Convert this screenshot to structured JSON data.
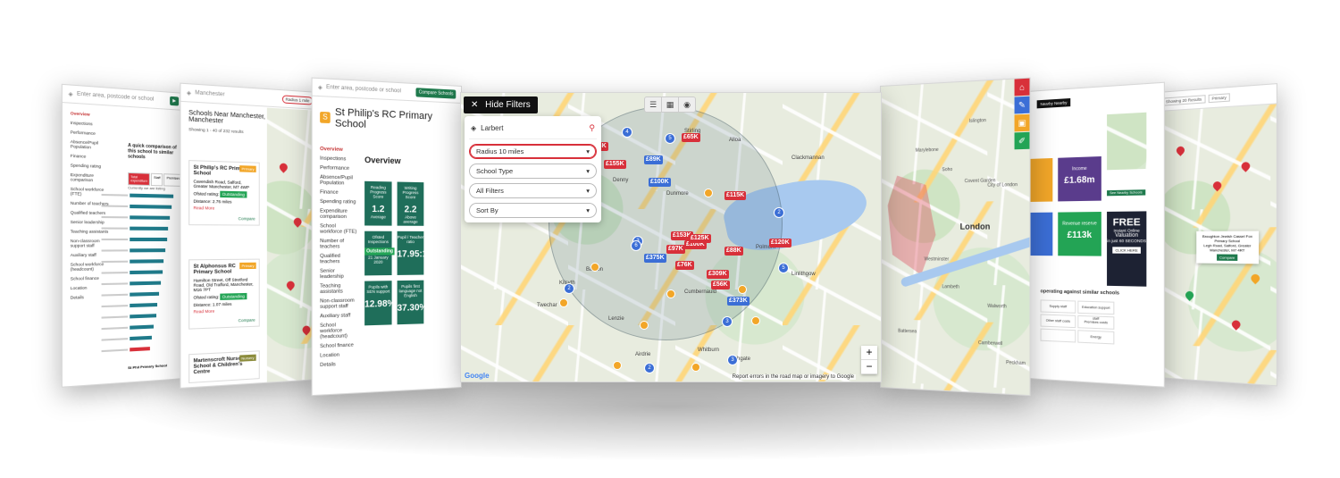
{
  "center": {
    "hide_filters": "Hide Filters",
    "search_value": "Larbert",
    "filters": [
      {
        "label": "Radius 10 miles",
        "active": true
      },
      {
        "label": "School Type",
        "active": false
      },
      {
        "label": "All Filters",
        "active": false
      },
      {
        "label": "Sort By",
        "active": false
      }
    ],
    "price_labels": [
      "£65K",
      "£173K",
      "£89K",
      "£155K",
      "£115K",
      "£100K",
      "£153K",
      "£100K",
      "£97K",
      "£375K",
      "£88K",
      "£56K",
      "£373K",
      "£76K",
      "£309K",
      "£120K",
      "£125K"
    ],
    "cluster_counts": [
      "4",
      "5",
      "3",
      "2",
      "6",
      "2",
      "3",
      "2",
      "3",
      "5"
    ],
    "place_names": [
      "Falkirk",
      "Denny",
      "Banton",
      "Kilsyth",
      "Twechar",
      "Lenzie",
      "Cumbernauld",
      "Airdrie",
      "Whitburn",
      "Bathgate",
      "Linlithgow",
      "Polmont",
      "Clackmannan",
      "Alloa",
      "Dunmore",
      "Stirling"
    ],
    "zoom_in": "+",
    "zoom_out": "−",
    "google": "Google",
    "report": "Report errors in the road map or imagery to Google"
  },
  "left1": {
    "search_placeholder": "Enter area, postcode or school",
    "compare_btn": "Compare Schools",
    "title": "St Philip's RC Primary School",
    "nav": [
      "Overview",
      "Inspections",
      "Performance",
      "Absence/Pupil Population",
      "Finance",
      "Spending rating",
      "Expenditure comparison",
      "School workforce (FTE)",
      "Number of teachers",
      "Qualified teachers",
      "Senior leadership",
      "Teaching assistants",
      "Non-classroom support staff",
      "Auxiliary staff",
      "School workforce (headcount)",
      "School finance",
      "Location",
      "Details"
    ],
    "overview": "Overview",
    "tiles": [
      {
        "label": "Reading Progress Score",
        "value": "1.2",
        "sub": "Average"
      },
      {
        "label": "Writing Progress Score",
        "value": "2.2",
        "sub": "Above average"
      },
      {
        "label": "Ofsted Inspections",
        "value": "Outstanding",
        "sub": "21 January 2020"
      },
      {
        "label": "Pupil / Teacher ratio",
        "value": "17.95:1",
        "sub": ""
      },
      {
        "label": "Pupils with SEN support",
        "value": "12.98%",
        "sub": ""
      },
      {
        "label": "Pupils first language not English",
        "value": "37.30%",
        "sub": ""
      }
    ]
  },
  "left2": {
    "search_value": "Manchester",
    "radius": "Radius 1 mile",
    "heading": "Schools Near Manchester, Manchester",
    "showing": "Showing 1 - 40 of 232 results",
    "cards": [
      {
        "name": "St Philip's RC Primary School",
        "tag": "Primary",
        "address": "Cavendish Road, Salford, Greater Manchester, M7 4WP",
        "ofsted_label": "Ofsted rating:",
        "rating": "Outstanding",
        "distance": "Distance: 2.76 miles",
        "more": "Read More",
        "compare": "Compare"
      },
      {
        "name": "St Alphonsus RC Primary School",
        "tag": "Primary",
        "address": "Hamilton Street, Off Stretford Road, Old Trafford, Manchester, M16 7PT",
        "ofsted_label": "Ofsted rating:",
        "rating": "Outstanding",
        "distance": "Distance: 1.07 miles",
        "more": "Read More",
        "compare": "Compare"
      },
      {
        "name": "Martenscroft Nursery School & Children's Centre",
        "tag": "Nursery",
        "address": "",
        "ofsted_label": "",
        "rating": "",
        "distance": "",
        "more": "",
        "compare": ""
      }
    ]
  },
  "left3": {
    "search_placeholder": "Enter area, postcode or school",
    "nav": [
      "Overview",
      "Inspections",
      "Performance",
      "Absence/Pupil Population",
      "Finance",
      "Spending rating",
      "Expenditure comparison",
      "School workforce (FTE)",
      "Number of teachers",
      "Qualified teachers",
      "Senior leadership",
      "Teaching assistants",
      "Non-classroom support staff",
      "Auxiliary staff",
      "School workforce (headcount)",
      "School finance",
      "Location",
      "Details"
    ],
    "quick_title": "A quick comparison of this school to similar schools",
    "tabs": [
      "Total expenditure",
      "Staff",
      "Premises",
      "Other"
    ],
    "currently": "Currently we are listing",
    "bar_values": [
      0.92,
      0.88,
      0.85,
      0.8,
      0.78,
      0.75,
      0.72,
      0.7,
      0.66,
      0.62,
      0.58,
      0.55,
      0.5,
      0.46,
      0.42
    ],
    "footer": "St Phil Primary School"
  },
  "right1": {
    "place_names": [
      "Islington",
      "Marylebone",
      "Soho",
      "Covent Garden",
      "City of London",
      "London",
      "Westminster",
      "Lambeth",
      "Walworth",
      "Camberwell",
      "Battersea",
      "Peckham"
    ],
    "tool_icons": [
      "home-icon",
      "brush-icon",
      "compare-icon",
      "ruler-icon"
    ]
  },
  "right2": {
    "nearby_btn": "Nearby Nearby",
    "income_label": "Income",
    "income_value": "£1.68m",
    "reserve_label": "Revenue reserve",
    "reserve_value": "£113k",
    "ad": {
      "free": "FREE",
      "line1": "Instant Online",
      "line2": "Valuation",
      "line3": "in just 60 SECONDS",
      "cta": "CLICK HERE"
    },
    "see_nearby": "See Nearby Schools",
    "heading": "operating against similar schools",
    "cells": [
      "Supply staff",
      "Education support staff",
      "Other staff costs",
      "Premises costs",
      "",
      "Energy"
    ]
  },
  "right3": {
    "controls": [
      "Showing 20 Results",
      "Primary"
    ],
    "popup_name": "Broughton Jewish Cassel Fox Primary School",
    "popup_addr": "Legh Road, Salford, Greater Manchester, M7 4RT",
    "popup_btn": "Compare"
  },
  "colors": {
    "red": "#d8303a",
    "blue_pin": "#3b6ed6",
    "orange": "#f2a628",
    "teal": "#1f6e5a",
    "green_btn": "#1f7a4d",
    "purple": "#5a3c8c"
  }
}
